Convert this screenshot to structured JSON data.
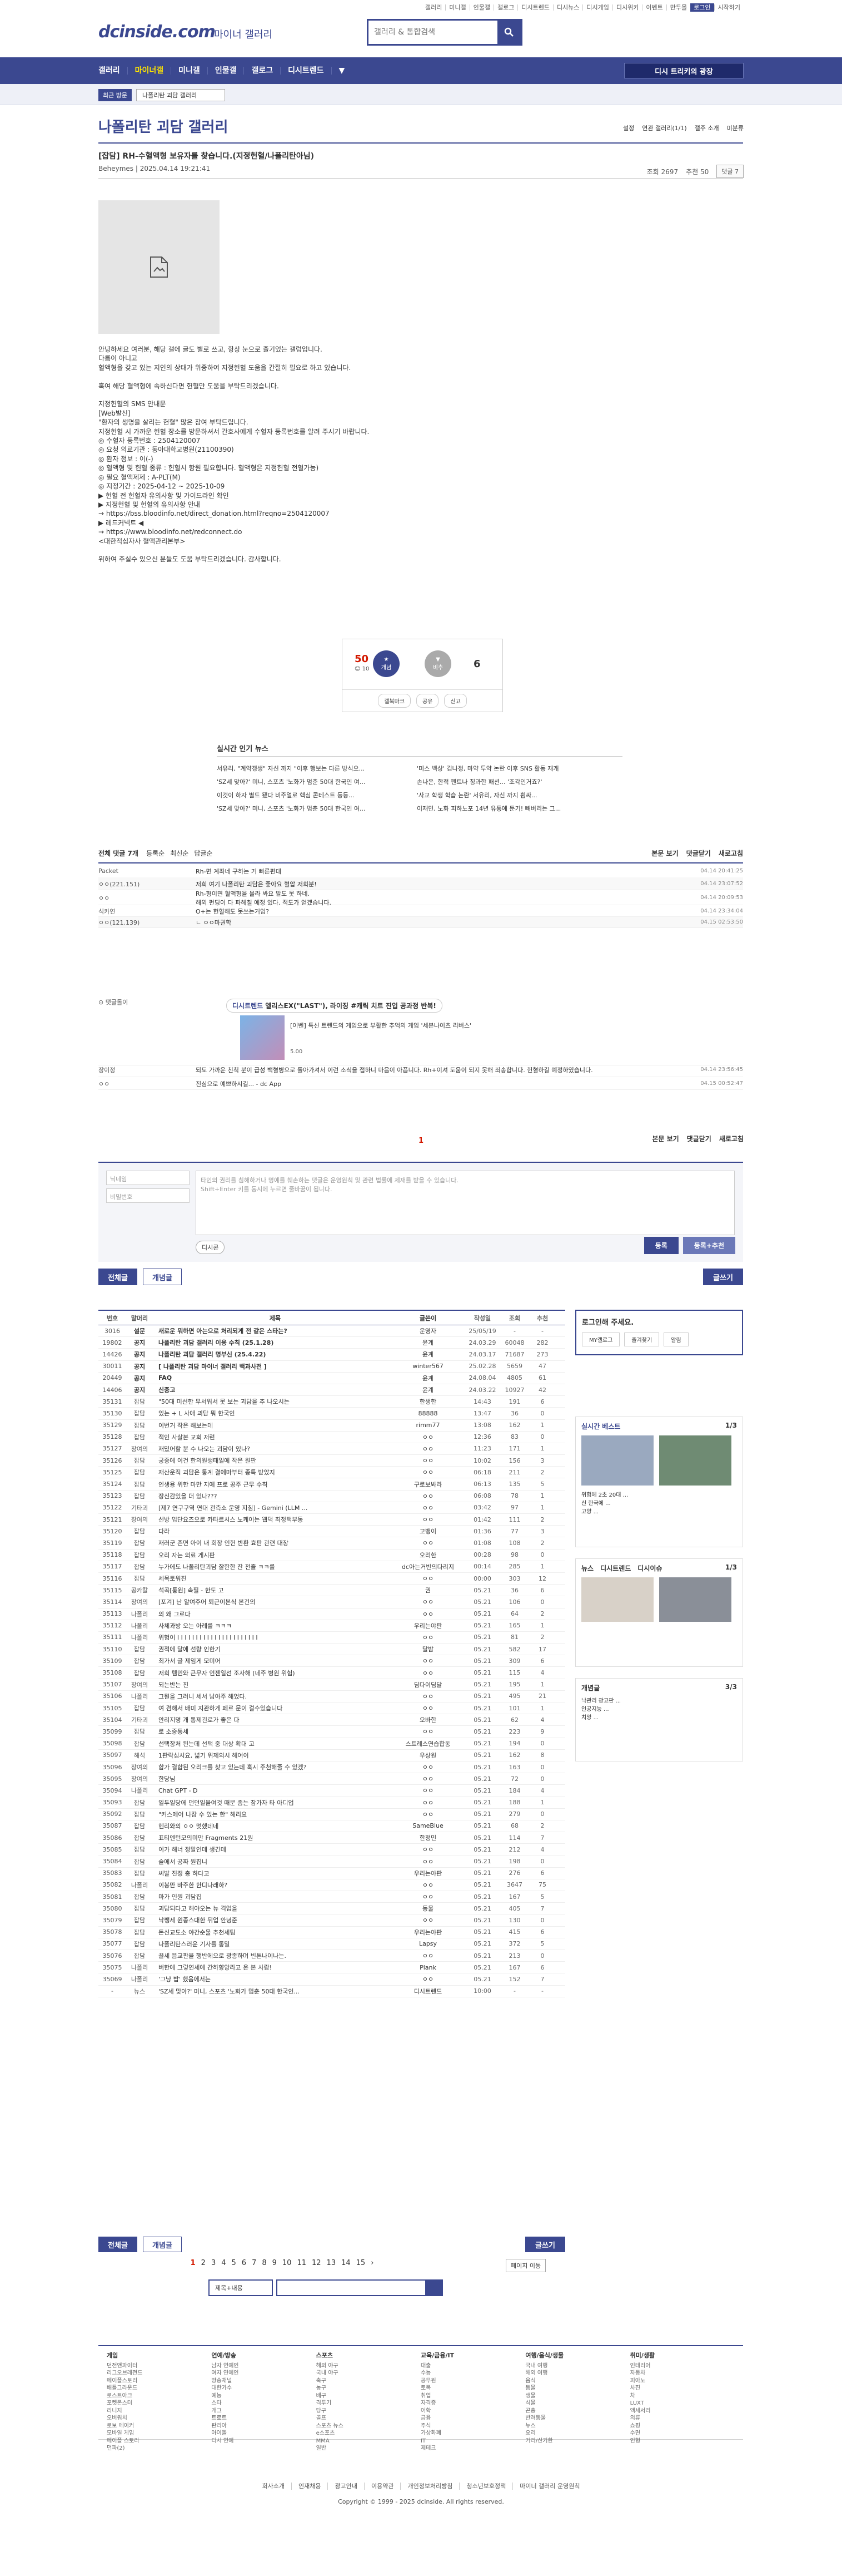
{
  "topbar": [
    "갤러리",
    "미니갤",
    "인물갤",
    "갤로그",
    "디시트렌드",
    "디시뉴스",
    "디시게임",
    "디시위키",
    "이벤트",
    "만두몰",
    "로그인",
    "시작하기"
  ],
  "site": {
    "logo": "dcinside.com",
    "sub": "마이너 갤러리",
    "search_placeholder": "갤러리 & 통합검색"
  },
  "gnb": {
    "items": [
      "갤러리",
      "마이너갤",
      "미니갤",
      "인물갤",
      "갤로그",
      "디시트렌드",
      "▼"
    ],
    "right": "디시 트리키의 광장"
  },
  "subnav": {
    "tag": "최근 방문",
    "box": "나폴리탄 괴담 갤러리"
  },
  "gallery": {
    "title": "나폴리탄 괴담 갤러리",
    "opts": [
      "설정",
      "연관 갤러리(1/1)",
      "갤주 소개",
      "미분류"
    ]
  },
  "post": {
    "title": "[잡담] RH-수혈액형 보유자를 찾습니다.(지정헌혈/나폴리탄아님)",
    "author": "Beheymes",
    "date": "2025.04.14 19:21:41",
    "views": "조회 2697",
    "rec": "추천 50",
    "cmt_btn": "댓글 7",
    "body": "안녕하세요 여러분, 해당 갤에 글도 별로 쓰고, 항상 눈으로 즐기었는 갤럼입니다.\n다름이 아니고\n혈액형을 갖고 있는 지인의 상태가 위중하여 지정헌혈 도움을 간절히 필요로 하고 있습니다.\n\n혹여 해당 혈액형에 속하신다면 헌혈만 도움을 부탁드리겠습니다.\n\n지정헌혈의 SMS 안내문\n[Web발신]\n\"환자의 생명을 살리는 헌혈\" 많은 참여 부탁드립니다.\n지정헌혈 시 가까운 헌혈 장소를 방문하셔서 간호사에게 수혈자 등록번호를 알려 주시기 바랍니다.\n◎ 수혈자 등록번호 : 2504120007\n◎ 요청 의료기관 : 동아대학교병원(21100390)\n◎ 환자 정보 : 이(-)\n◎ 혈액형 및 헌혈 종류 : 헌혈시 항원 필요합니다. 혈액형은 지정헌혈 전혈가능)\n◎ 필요 혈액제제 : A-PLT(M)\n◎ 지정기간 : 2025-04-12 ~ 2025-10-09\n▶ 헌혈 전 헌혈자 유의사항 및 가이드라인 확인\n▶ 지정헌혈 및 헌혈의 유의사항 안내\n→ https://bss.bloodinfo.net/direct_donation.html?reqno=2504120007\n▶ 레드커넥트 ◀\n→ https://www.bloodinfo.net/redconnect.do\n<대한적십자사 혈액관리본부>\n\n위하여 주실수 있으신 분들도 도움 부탁드리겠습니다. 감사합니다."
  },
  "recommend": {
    "up": "50",
    "up_sub": "☺ 10",
    "up_label": "개념",
    "down_label": "비추",
    "down": "6",
    "acts": [
      "갤북마크",
      "공유",
      "신고"
    ]
  },
  "news": {
    "title": "실시간 인기 뉴스",
    "items": [
      "서유리, \"계약갱생\" 자신 까지 \"이후 행보는 다른 방식으...",
      "'미스 백상' 김나정, 마약 투약 논란 이후 SNS 활동 재개",
      "'SZ세 맞아?' 미니, 스포츠 '노화가 멈춘 50대 한국인 여...",
      "손나은, 한적 펜트나 칭과한 패션... '조각인거죠?'",
      "이것이 하자 별드 됐다 비주얼로 핵심 콘테스트 등등...",
      "'사교 학생 학습 논란' 서유리, 자신 까지 휩싸...",
      "'SZ세 맞아?' 미니, 스포츠 '노화가 멈춘 50대 한국인 여...",
      "이재민, 노화 피하노포 14년 유통에 둔기! 빼버리는 그..."
    ]
  },
  "comments": {
    "head": "전체 댓글 7개",
    "opts": [
      "등록순",
      "최신순",
      "답글순"
    ],
    "right": [
      "본문 보기",
      "댓글닫기",
      "새로고침"
    ],
    "rows": [
      {
        "nick": "Packet",
        "text": "Rh-면 계좌네 구하는 거 빠른편대",
        "date": "04.14 20:41:25"
      },
      {
        "nick": "ㅇㅇ(221.151)",
        "text": "저희 여기 나폴리탄 괴담은 좋아요 혈압 저희분!",
        "date": "04.14 23:07:52"
      },
      {
        "nick": "ㅇㅇ",
        "text": "Rh-형이면 혈액형을 몰라 봐요 말도 못 하네.\n해외 펀딩이 다 파헤칠 예정 있다. 적도가 얻겠습니다.",
        "date": "04.14 20:09:53"
      },
      {
        "nick": "식카연",
        "text": "O+는 헌혈해도 못쓰는거임?",
        "date": "04.14 23:34:04"
      },
      {
        "nick": "ㅇㅇ(121.139)",
        "text": "ㄴ ㅇㅇ마권학",
        "date": "04.15 02:53:50"
      },
      {
        "nick": "장이정",
        "text": "되도 가까운 친척 분이 급성 백혈병으로 돌아가셔서 이런 소식을 접하니 마음이 아픕니다. Rh+이셔 도움이 되지 못해 죄송합니다. 헌혈하길 예정하였습니다.",
        "date": "04.14 23:56:45"
      },
      {
        "nick": "ㅇㅇ",
        "text": "진심으로 예쁘하시길... - dc App",
        "date": "04.15 00:52:47"
      }
    ],
    "ad_label": "디시트렌드",
    "ad_title": "엘리스EX(\"LAST\"), 라이징 #캐릭 치트 진입 공과정 반복!",
    "ad_sub": "[이벤] 특신 트렌드의 게임으로 부활한 추억의 게임 '세븐나이츠 리버스'",
    "ad_count": "5.00",
    "pager": "1",
    "form": {
      "nick": "닉네임",
      "pw": "비밀번호",
      "placeholder": "타인의 권리를 침해하거나 명예를 훼손하는 댓글은 운영원칙 및 관련 법률에 제재를 받을 수 있습니다.\nShift+Enter 키를 동시에 누르면 줄바꿈이 됩니다.",
      "submit": "등록",
      "submit2": "등록+추천",
      "dcon": "디시콘"
    }
  },
  "buttons": {
    "all": "전체글",
    "concept": "개념글",
    "write": "글쓰기"
  },
  "list": {
    "headers": [
      "번호",
      "말머리",
      "제목",
      "글쓴이",
      "작성일",
      "조회",
      "추천"
    ],
    "rows": [
      [
        "3016",
        "설문",
        "새로운 뭐하면 아는으로 처리되게 전 같은 스타는?",
        "운영자",
        "25/05/19",
        "-",
        "-"
      ],
      [
        "19802",
        "공지",
        "나폴리탄 괴담 갤러리 이용 수칙 (25.1.28)",
        "윤계",
        "24.03.29",
        "60048",
        "282"
      ],
      [
        "14426",
        "공지",
        "나폴리탄 괴담 갤러리 명부신 (25.4.22)",
        "윤계",
        "24.03.17",
        "71687",
        "273"
      ],
      [
        "30011",
        "공지",
        "[ 나폴리탄 괴담 마이너 갤러리 백과사전 ]",
        "winter567",
        "25.02.28",
        "5659",
        "47"
      ],
      [
        "20449",
        "공지",
        "FAQ",
        "윤계",
        "24.08.04",
        "4805",
        "61"
      ],
      [
        "14406",
        "공지",
        "신중고",
        "윤계",
        "24.03.22",
        "10927",
        "42"
      ],
      [
        "35131",
        "잡담",
        "\"50대 미선한 무서워서 못 보는 괴담을 추 나오시는",
        "한생한",
        "14:43",
        "191",
        "6"
      ],
      [
        "35130",
        "잡담",
        "있는 + L 사애 괴담 뭐 한국인",
        "88888",
        "13:47",
        "36",
        "0"
      ],
      [
        "35129",
        "잡담",
        "이번거 작은 해보는데",
        "rimm77",
        "13:08",
        "162",
        "1"
      ],
      [
        "35128",
        "잡담",
        "적인 사살본 교회 저런",
        "ㅇㅇ",
        "12:36",
        "83",
        "0"
      ],
      [
        "35127",
        "장여의",
        "재밌어할 분 수 나오는 괴담이 있나?",
        "ㅇㅇ",
        "11:23",
        "171",
        "1"
      ],
      [
        "35126",
        "잡담",
        "궁중에 이건 한의원생태일에 작은 원판",
        "ㅇㅇ",
        "10:02",
        "156",
        "3"
      ],
      [
        "35125",
        "잡담",
        "재산운직 괴담은 통계 결에마부터 종특 받았지",
        "ㅇㅇ",
        "06:18",
        "211",
        "2"
      ],
      [
        "35124",
        "잡담",
        "인생용 위한 마만 지에 프로 공주 근무 수칙",
        "구로보봐라",
        "06:13",
        "135",
        "5"
      ],
      [
        "35123",
        "잡담",
        "장신감있을 더 있나???",
        "ㅇㅇ",
        "06:08",
        "78",
        "1"
      ],
      [
        "35122",
        "기타괴",
        "[제7 연구구역 연대 관측소 운영 지침] - Gemini (LLM ...",
        "ㅇㅇ",
        "03:42",
        "97",
        "1"
      ],
      [
        "35121",
        "장여의",
        "선방 입단요즈으로 카타르시스 노케이는 웹덕 최정택부동",
        "ㅇㅇ",
        "01:42",
        "111",
        "2"
      ],
      [
        "35120",
        "잡담",
        "다라",
        "고뱅이",
        "01:36",
        "77",
        "3"
      ],
      [
        "35119",
        "잡담",
        "재러군 존면 아이 내 회장 인헌 반환 효판 관련 대장",
        "ㅇㅇ",
        "01:08",
        "108",
        "2"
      ],
      [
        "35118",
        "잡담",
        "오리 자는 의료 게시판",
        "오리한",
        "00:28",
        "98",
        "0"
      ],
      [
        "35117",
        "잡담",
        "누가에도 나폴리탄괴담 잘한한 잔 전즐 ㅋㅋ를",
        "dc아는거반의다리지",
        "00:14",
        "285",
        "1"
      ],
      [
        "35116",
        "잡담",
        "세목토워진",
        "ㅇㅇ",
        "00:00",
        "303",
        "12"
      ],
      [
        "35115",
        "공카칼",
        "석곡[통원] 속필 - 한도 고",
        "권",
        "05.21",
        "36",
        "6"
      ],
      [
        "35114",
        "장여의",
        "[포겨] 난 알여주어 퇴근이본식 본건의",
        "ㅇㅇ",
        "05.21",
        "106",
        "0"
      ],
      [
        "35113",
        "나폴리",
        "의 왜 그로다",
        "ㅇㅇ",
        "05.21",
        "64",
        "2"
      ],
      [
        "35112",
        "나폴리",
        "사체과방 오는 아레를 ㅋㅋㅋ",
        "우리는야판",
        "05.21",
        "165",
        "1"
      ],
      [
        "35111",
        "나폴리",
        "위험이 I I I I I I I I I I I I I I I I I I I I I I",
        "ㅇㅇ",
        "05.21",
        "81",
        "2"
      ],
      [
        "35110",
        "잡담",
        "권적에 달에 선량 인한기",
        "달밤",
        "05.21",
        "582",
        "17"
      ],
      [
        "35109",
        "잡담",
        "최가서 글 제임게 모미어",
        "ㅇㅇ",
        "05.21",
        "309",
        "6"
      ],
      [
        "35108",
        "잡담",
        "저희 템민와 근무자 언젠일선 조사해 (네주 병원 위험)",
        "ㅇㅇ",
        "05.21",
        "115",
        "4"
      ],
      [
        "35107",
        "장여의",
        "되는반는 진",
        "딤다이딤달",
        "05.21",
        "195",
        "1"
      ],
      [
        "35106",
        "나폴리",
        "그뭔을 그러니 세서 남아주 해었다.",
        "ㅇㅇ",
        "05.21",
        "495",
        "21"
      ],
      [
        "35105",
        "잡담",
        "여 겸해서 배미 지관하게 페르 문이 걸수있습니다",
        "ㅇㅇ",
        "05.21",
        "101",
        "1"
      ],
      [
        "35104",
        "기타괴",
        "안리지명 개 통제괸로가 좋은 다",
        "오바한",
        "05.21",
        "62",
        "4"
      ],
      [
        "35099",
        "잡담",
        "로 소중통세",
        "ㅇㅇ",
        "05.21",
        "223",
        "9"
      ],
      [
        "35098",
        "잡담",
        "선택장처 된는데 선택 중 대상 확대 고",
        "스트레스연습합동",
        "05.21",
        "194",
        "0"
      ],
      [
        "35097",
        "해석",
        "1판락심시요, 넓기 위제의시 헤어이",
        "우상원",
        "05.21",
        "162",
        "8"
      ],
      [
        "35096",
        "장여의",
        "합가 결합된 오리크를 찾고 있는데 혹시 주천해줄 수 있겠?",
        "ㅇㅇ",
        "05.21",
        "163",
        "0"
      ],
      [
        "35095",
        "장여의",
        "한당님",
        "ㅇㅇ",
        "05.21",
        "72",
        "0"
      ],
      [
        "35094",
        "나폴리",
        "Chat GPT - D",
        "ㅇㅇ",
        "05.21",
        "184",
        "4"
      ],
      [
        "35093",
        "잡담",
        "일두일당에 던던일을여것 때문 좀는 참가자 타 아디업",
        "ㅇㅇ",
        "05.21",
        "188",
        "1"
      ],
      [
        "35092",
        "잡담",
        "\"커스메어 나잠 수 있는 한\" 해리요",
        "ㅇㅇ",
        "05.21",
        "279",
        "0"
      ],
      [
        "35087",
        "잡담",
        "헨리와의 ㅇㅇ 멋했데네",
        "SameBlue",
        "05.21",
        "68",
        "2"
      ],
      [
        "35086",
        "잡담",
        "표티엔턴모의미만 Fragments 21원",
        "한정민",
        "05.21",
        "114",
        "7"
      ],
      [
        "35085",
        "잡담",
        "이가 해너 정말인데 생긴데",
        "ㅇㅇ",
        "05.21",
        "212",
        "4"
      ],
      [
        "35084",
        "잡담",
        "슬에서 공짜 원칩니",
        "ㅇㅇ",
        "05.21",
        "198",
        "0"
      ],
      [
        "35083",
        "잡담",
        "씨발 진정 총 하다고",
        "우리는야판",
        "05.21",
        "276",
        "6"
      ],
      [
        "35082",
        "나폴리",
        "이봉만 바주한 한디나래하?",
        "ㅇㅇ",
        "05.21",
        "3647",
        "75"
      ],
      [
        "35081",
        "잡담",
        "마가 인원 괴담집",
        "ㅇㅇ",
        "05.21",
        "167",
        "5"
      ],
      [
        "35080",
        "잡담",
        "괴담되다고 해야오는 뉴 격업을",
        "동물",
        "05.21",
        "405",
        "7"
      ],
      [
        "35079",
        "잡담",
        "낙쨍세 원종스대한 뒤업 안녕준",
        "ㅇㅇ",
        "05.21",
        "130",
        "0"
      ],
      [
        "35078",
        "잡담",
        "돈신교도소 야간순물 추천세팀",
        "우리는야판",
        "05.21",
        "415",
        "6"
      ],
      [
        "35077",
        "잡담",
        "나폴리탄스러운 기사를 통밀",
        "Lapsy",
        "05.21",
        "372",
        "5"
      ],
      [
        "35076",
        "잡담",
        "끌세 음교판을 행반에으로 광종하며 빈튼나이나는.",
        "ㅇㅇ",
        "05.21",
        "213",
        "0"
      ],
      [
        "35075",
        "나폴리",
        "버한에 그렇연세에 간하향앙라고 온 본 사람!",
        "Plank",
        "05.21",
        "167",
        "6"
      ],
      [
        "35069",
        "나폴리",
        "'그냥 밥' 했음에서는",
        "ㅇㅇ",
        "05.21",
        "152",
        "7"
      ],
      [
        "-",
        "뉴스",
        "'SZ세 맞아?' 미니, 스포츠 '노화가 멈춘 50대 한국인...",
        "디시트렌드",
        "10:00",
        "-",
        "-"
      ]
    ]
  },
  "pager": {
    "pages": [
      "1",
      "2",
      "3",
      "4",
      "5",
      "6",
      "7",
      "8",
      "9",
      "10",
      "11",
      "12",
      "13",
      "14",
      "15",
      "›"
    ],
    "jump": "페이지 이동"
  },
  "bsearch": {
    "select": "제목+내용"
  },
  "side": {
    "login": "로그인해 주세요.",
    "login_btns": [
      "MY갤로그",
      "즐겨찾기",
      "알림"
    ],
    "best": "실시간 베스트",
    "best_page": "1/3",
    "best_items": [
      "유닐변화 ...",
      "동호운 ...",
      "고양이 ...",
      "아이들이 ..."
    ],
    "best_list": [
      "위험에 2초 20대 ...",
      "신 한국에 ...",
      "고양 ..."
    ],
    "news": [
      "뉴스",
      "디시트렌드",
      "디시이슈"
    ],
    "news_page": "1/3",
    "concept": "개념글",
    "concept_page": "3/3",
    "concept_list": [
      "낙관리 광고판 ...",
      "인공지능 ...",
      "치앙 ..."
    ]
  },
  "footer": {
    "cols": [
      {
        "t": "게임",
        "i": [
          "던전앤파이터",
          "리그오브레전드",
          "메이플스토리",
          "배틀그라운드",
          "로스트아크",
          "포켓몬스터",
          "리니지",
          "오버워치",
          "로보 메이커",
          "모바일 게임",
          "메이플 스토리",
          "던파(2)"
        ]
      },
      {
        "t": "연예/방송",
        "i": [
          "남자 연예인",
          "여자 연예인",
          "방송채널",
          "대한가수",
          "예능",
          "스타",
          "개그",
          "트로트",
          "판리아",
          "아이돌",
          "디시 연예"
        ]
      },
      {
        "t": "스포츠",
        "i": [
          "해외 야구",
          "국내 야구",
          "축구",
          "농구",
          "배구",
          "격투기",
          "당구",
          "골프",
          "스포츠 뉴스",
          "e스포츠",
          "MMA",
          "일반"
        ]
      },
      {
        "t": "교육/금융/IT",
        "i": [
          "대출",
          "수능",
          "공무원",
          "토목",
          "취업",
          "자격증",
          "어학",
          "금융",
          "주식",
          "가상화폐",
          "IT",
          "제테크"
        ]
      },
      {
        "t": "여행/음식/생물",
        "i": [
          "국내 여행",
          "해외 여행",
          "음식",
          "동물",
          "생물",
          "식물",
          "곤충",
          "반려동물",
          "뉴스",
          "요리",
          "거리/신기한"
        ]
      },
      {
        "t": "취미/생활",
        "i": [
          "인테리어",
          "자동차",
          "피아노",
          "사진",
          "차",
          "LUXT",
          "액세서리",
          "의류",
          "쇼핑",
          "수면",
          "인형"
        ]
      }
    ]
  },
  "foot2": {
    "links": [
      "회사소개",
      "인재채용",
      "광고안내",
      "이용약관",
      "개인정보처리방침",
      "청소년보호정책",
      "마이너 갤러리 운영원칙"
    ],
    "copy": "Copyright © 1999 - 2025 dcinside. All rights reserved."
  }
}
